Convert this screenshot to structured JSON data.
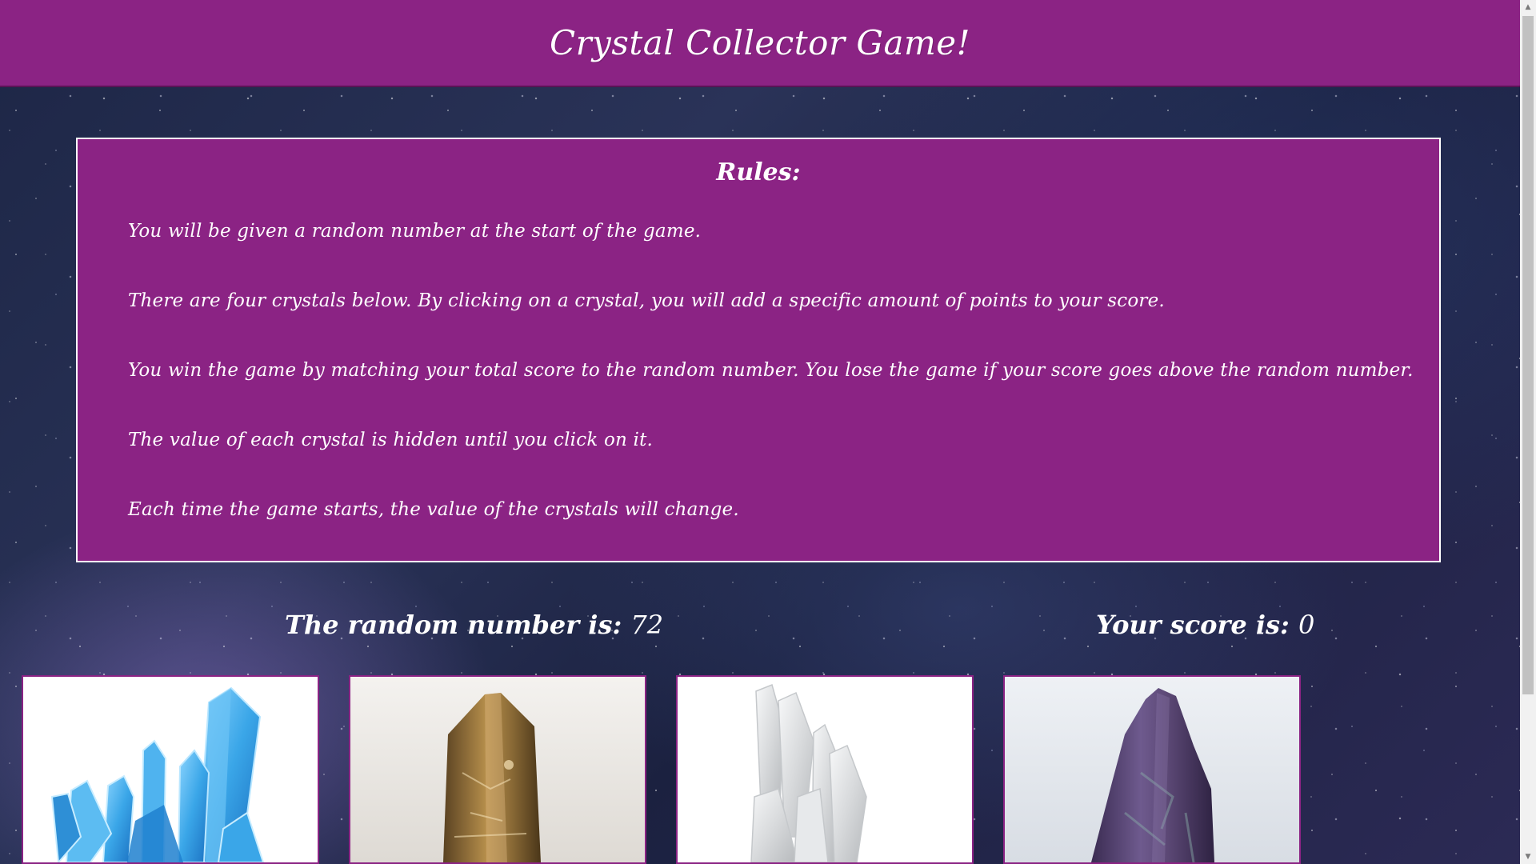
{
  "header": {
    "title": "Crystal Collector Game!"
  },
  "rules": {
    "heading": "Rules:",
    "lines": [
      "You will be given a random number at the start of the game.",
      "There are four crystals below. By clicking on a crystal, you will add a specific amount of points to your score.",
      "You win the game by matching your total score to the random number. You lose the game if your score goes above the random number.",
      "The value of each crystal is hidden until you click on it.",
      "Each time the game starts, the value of the crystals will change."
    ]
  },
  "stats": {
    "random_label": "The random number is:",
    "random_value": "72",
    "score_label": "Your score is:",
    "score_value": "0"
  },
  "crystals": [
    {
      "name": "blue-aura-crystal",
      "color": "#3aa6e8"
    },
    {
      "name": "smoky-citrine-crystal",
      "color": "#8a6a36"
    },
    {
      "name": "clear-quartz-crystal",
      "color": "#d8dadc"
    },
    {
      "name": "amethyst-crystal",
      "color": "#5e4a78"
    }
  ],
  "colors": {
    "primary": "#8b2384",
    "text": "#ffffff",
    "border": "#ffffff"
  }
}
